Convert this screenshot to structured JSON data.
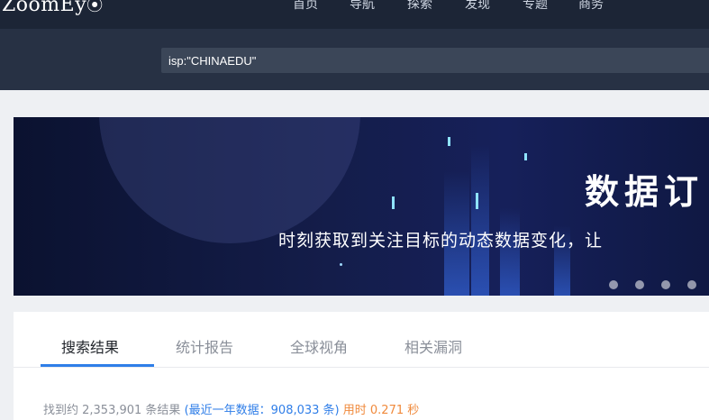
{
  "nav": {
    "logo_text": "ZoomEy",
    "logo_icon": "eye-icon",
    "items": [
      "首页",
      "导航",
      "探索",
      "发现",
      "专题",
      "商务"
    ]
  },
  "search": {
    "value": "isp:\"CHINAEDU\""
  },
  "banner": {
    "title": "数据订",
    "subtitle": "时刻获取到关注目标的动态数据变化，让"
  },
  "tabs": [
    "搜索结果",
    "统计报告",
    "全球视角",
    "相关漏洞"
  ],
  "results": {
    "prefix": "找到约 2,353,901 条结果",
    "recent": "(最近一年数据：908,033 条)",
    "time": "用时 0.271 秒"
  },
  "colors": {
    "nav_bg": "#1c2536",
    "search_bg": "#273144",
    "accent_blue": "#2f7ee8",
    "time_orange": "#f08a3c"
  }
}
